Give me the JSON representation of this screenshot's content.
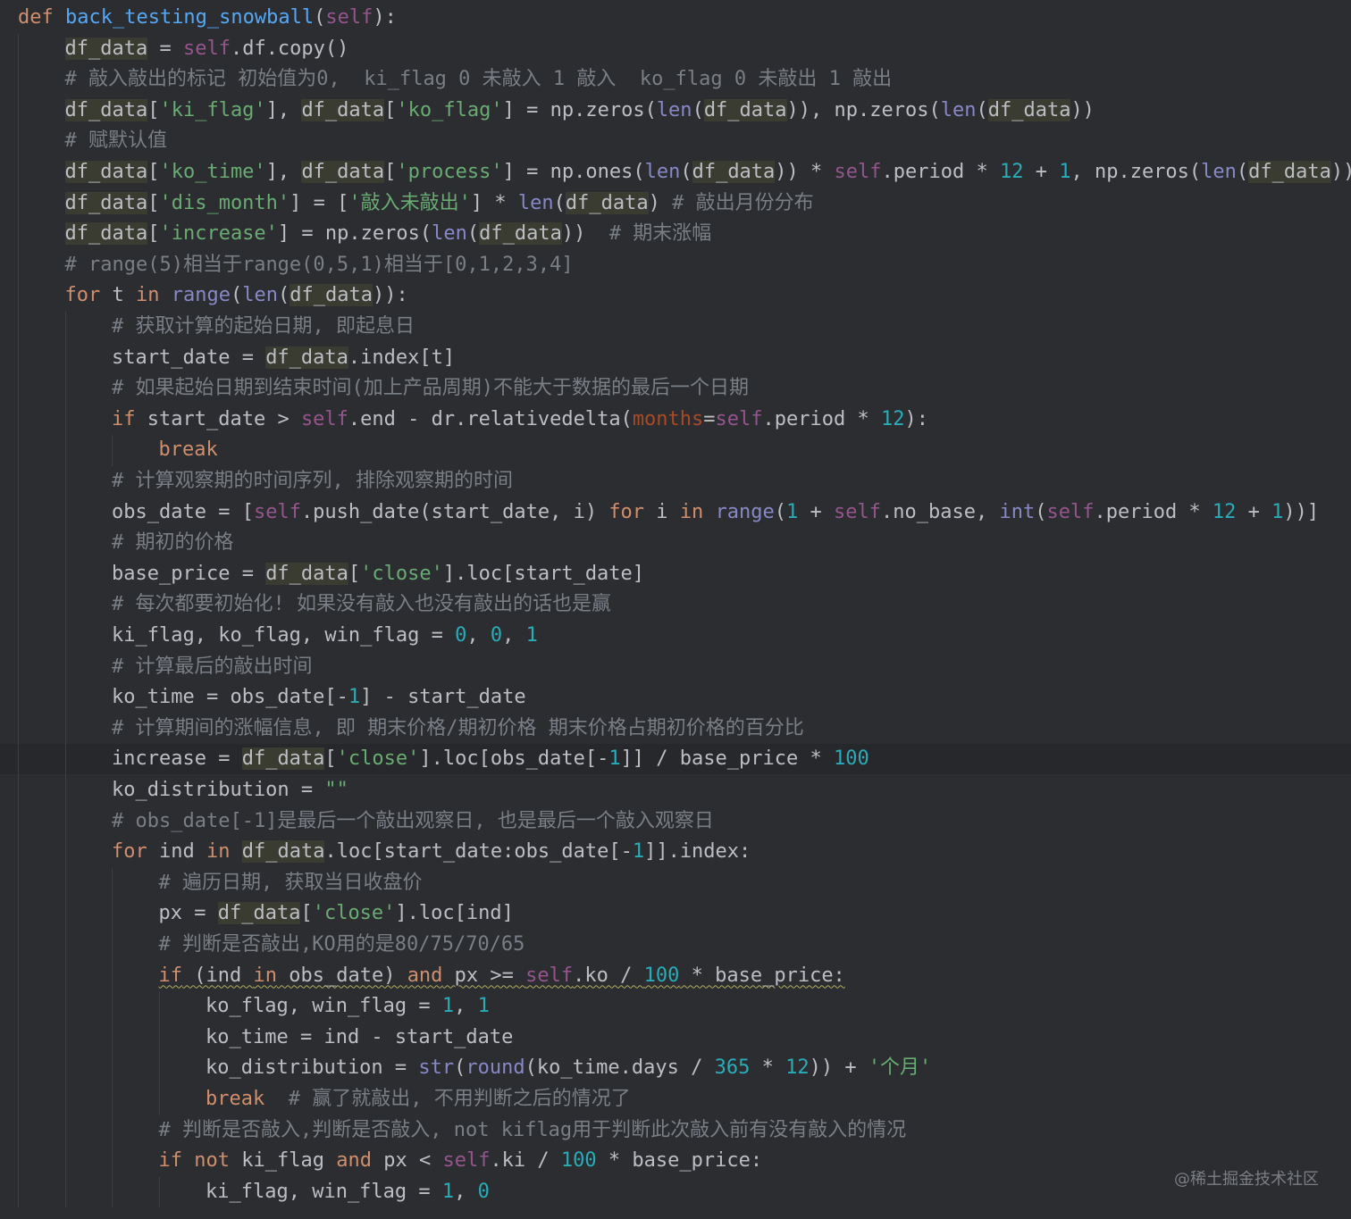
{
  "colors": {
    "background": "#2b2d30",
    "current_line": "#26282b",
    "default_text": "#bcbec4",
    "keyword": "#cf8e6d",
    "function_name": "#56a8f5",
    "builtin": "#8888c6",
    "self": "#94558d",
    "string": "#6aab73",
    "number": "#2aacb8",
    "comment": "#7a7e85",
    "named_param": "#aa4926"
  },
  "editor": {
    "current_line_index": 24,
    "lines": [
      {
        "indent": 0,
        "tokens": [
          [
            "kw",
            "def "
          ],
          [
            "fn",
            "back_testing_snowball"
          ],
          [
            "p",
            "("
          ],
          [
            "slf",
            "self"
          ],
          [
            "p",
            "):"
          ]
        ]
      },
      {
        "indent": 1,
        "tokens": [
          [
            "var",
            "df_data"
          ],
          [
            "p",
            " = "
          ],
          [
            "slf",
            "self"
          ],
          [
            "p",
            ".df.copy()"
          ]
        ]
      },
      {
        "indent": 1,
        "tokens": [
          [
            "cmt",
            "# 敲入敲出的标记 初始值为0,  ki_flag 0 未敲入 1 敲入  ko_flag 0 未敲出 1 敲出"
          ]
        ]
      },
      {
        "indent": 1,
        "tokens": [
          [
            "var",
            "df_data"
          ],
          [
            "p",
            "["
          ],
          [
            "str",
            "'ki_flag'"
          ],
          [
            "p",
            "], "
          ],
          [
            "var",
            "df_data"
          ],
          [
            "p",
            "["
          ],
          [
            "str",
            "'ko_flag'"
          ],
          [
            "p",
            "] = np.zeros("
          ],
          [
            "bi",
            "len"
          ],
          [
            "p",
            "("
          ],
          [
            "var",
            "df_data"
          ],
          [
            "p",
            ")), np.zeros("
          ],
          [
            "bi",
            "len"
          ],
          [
            "p",
            "("
          ],
          [
            "var",
            "df_data"
          ],
          [
            "p",
            "))"
          ]
        ]
      },
      {
        "indent": 1,
        "tokens": [
          [
            "cmt",
            "# 赋默认值"
          ]
        ]
      },
      {
        "indent": 1,
        "tokens": [
          [
            "var",
            "df_data"
          ],
          [
            "p",
            "["
          ],
          [
            "str",
            "'ko_time'"
          ],
          [
            "p",
            "], "
          ],
          [
            "var",
            "df_data"
          ],
          [
            "p",
            "["
          ],
          [
            "str",
            "'process'"
          ],
          [
            "p",
            "] = np.ones("
          ],
          [
            "bi",
            "len"
          ],
          [
            "p",
            "("
          ],
          [
            "var",
            "df_data"
          ],
          [
            "p",
            ")) * "
          ],
          [
            "slf",
            "self"
          ],
          [
            "p",
            ".period * "
          ],
          [
            "num",
            "12"
          ],
          [
            "p",
            " + "
          ],
          [
            "num",
            "1"
          ],
          [
            "p",
            ", np.zeros("
          ],
          [
            "bi",
            "len"
          ],
          [
            "p",
            "("
          ],
          [
            "var",
            "df_data"
          ],
          [
            "p",
            "))"
          ]
        ]
      },
      {
        "indent": 1,
        "tokens": [
          [
            "var",
            "df_data"
          ],
          [
            "p",
            "["
          ],
          [
            "str",
            "'dis_month'"
          ],
          [
            "p",
            "] = ["
          ],
          [
            "str",
            "'敲入未敲出'"
          ],
          [
            "p",
            "] * "
          ],
          [
            "bi",
            "len"
          ],
          [
            "p",
            "("
          ],
          [
            "var",
            "df_data"
          ],
          [
            "p",
            ") "
          ],
          [
            "cmt",
            "# 敲出月份分布"
          ]
        ]
      },
      {
        "indent": 1,
        "tokens": [
          [
            "var",
            "df_data"
          ],
          [
            "p",
            "["
          ],
          [
            "str",
            "'increase'"
          ],
          [
            "p",
            "] = np.zeros("
          ],
          [
            "bi",
            "len"
          ],
          [
            "p",
            "("
          ],
          [
            "var",
            "df_data"
          ],
          [
            "p",
            "))  "
          ],
          [
            "cmt",
            "# 期末涨幅"
          ]
        ]
      },
      {
        "indent": 1,
        "tokens": [
          [
            "cmt",
            "# range(5)相当于range(0,5,1)相当于[0,1,2,3,4]"
          ]
        ]
      },
      {
        "indent": 1,
        "tokens": [
          [
            "kw",
            "for"
          ],
          [
            "p",
            " t "
          ],
          [
            "kw",
            "in"
          ],
          [
            "p",
            " "
          ],
          [
            "bi",
            "range"
          ],
          [
            "p",
            "("
          ],
          [
            "bi",
            "len"
          ],
          [
            "p",
            "("
          ],
          [
            "var",
            "df_data"
          ],
          [
            "p",
            "))"
          ],
          [
            "p",
            ":"
          ]
        ]
      },
      {
        "indent": 2,
        "tokens": [
          [
            "cmt",
            "# 获取计算的起始日期, 即起息日"
          ]
        ]
      },
      {
        "indent": 2,
        "tokens": [
          [
            "p",
            "start_date = "
          ],
          [
            "var",
            "df_data"
          ],
          [
            "p",
            ".index[t]"
          ]
        ]
      },
      {
        "indent": 2,
        "tokens": [
          [
            "cmt",
            "# 如果起始日期到结束时间(加上产品周期)不能大于数据的最后一个日期"
          ]
        ]
      },
      {
        "indent": 2,
        "tokens": [
          [
            "kw",
            "if"
          ],
          [
            "p",
            " start_date > "
          ],
          [
            "slf",
            "self"
          ],
          [
            "p",
            ".end - dr.relativedelta("
          ],
          [
            "prm",
            "months"
          ],
          [
            "p",
            "="
          ],
          [
            "slf",
            "self"
          ],
          [
            "p",
            ".period * "
          ],
          [
            "num",
            "12"
          ],
          [
            "p",
            "):"
          ]
        ]
      },
      {
        "indent": 3,
        "tokens": [
          [
            "kw",
            "break"
          ]
        ]
      },
      {
        "indent": 2,
        "tokens": [
          [
            "cmt",
            "# 计算观察期的时间序列, 排除观察期的时间"
          ]
        ]
      },
      {
        "indent": 2,
        "tokens": [
          [
            "p",
            "obs_date = ["
          ],
          [
            "slf",
            "self"
          ],
          [
            "p",
            ".push_date(start_date, i) "
          ],
          [
            "kw",
            "for"
          ],
          [
            "p",
            " i "
          ],
          [
            "kw",
            "in"
          ],
          [
            "p",
            " "
          ],
          [
            "bi",
            "range"
          ],
          [
            "p",
            "("
          ],
          [
            "num",
            "1"
          ],
          [
            "p",
            " + "
          ],
          [
            "slf",
            "self"
          ],
          [
            "p",
            ".no_base, "
          ],
          [
            "bi",
            "int"
          ],
          [
            "p",
            "("
          ],
          [
            "slf",
            "self"
          ],
          [
            "p",
            ".period * "
          ],
          [
            "num",
            "12"
          ],
          [
            "p",
            " + "
          ],
          [
            "num",
            "1"
          ],
          [
            "p",
            "))]"
          ]
        ]
      },
      {
        "indent": 2,
        "tokens": [
          [
            "cmt",
            "# 期初的价格"
          ]
        ]
      },
      {
        "indent": 2,
        "tokens": [
          [
            "p",
            "base_price = "
          ],
          [
            "var",
            "df_data"
          ],
          [
            "p",
            "["
          ],
          [
            "str",
            "'close'"
          ],
          [
            "p",
            "].loc[start_date]"
          ]
        ]
      },
      {
        "indent": 2,
        "tokens": [
          [
            "cmt",
            "# 每次都要初始化! 如果没有敲入也没有敲出的话也是赢"
          ]
        ]
      },
      {
        "indent": 2,
        "tokens": [
          [
            "p",
            "ki_flag, ko_flag, win_flag = "
          ],
          [
            "num",
            "0"
          ],
          [
            "p",
            ", "
          ],
          [
            "num",
            "0"
          ],
          [
            "p",
            ", "
          ],
          [
            "num",
            "1"
          ]
        ]
      },
      {
        "indent": 2,
        "tokens": [
          [
            "cmt",
            "# 计算最后的敲出时间"
          ]
        ]
      },
      {
        "indent": 2,
        "tokens": [
          [
            "p",
            "ko_time = obs_date[-"
          ],
          [
            "num",
            "1"
          ],
          [
            "p",
            "] - start_date"
          ]
        ]
      },
      {
        "indent": 2,
        "tokens": [
          [
            "cmt",
            "# 计算期间的涨幅信息, 即 期末价格/期初价格 期末价格占期初价格的百分比"
          ]
        ]
      },
      {
        "indent": 2,
        "tokens": [
          [
            "p",
            "increase = "
          ],
          [
            "var",
            "df_data"
          ],
          [
            "p",
            "["
          ],
          [
            "str",
            "'close'"
          ],
          [
            "p",
            "].loc[obs_date[-"
          ],
          [
            "num",
            "1"
          ],
          [
            "p",
            "]] / base_price * "
          ],
          [
            "num",
            "100"
          ]
        ]
      },
      {
        "indent": 2,
        "tokens": [
          [
            "p",
            "ko_distribution = "
          ],
          [
            "str",
            "\"\""
          ]
        ]
      },
      {
        "indent": 2,
        "tokens": [
          [
            "cmt",
            "# obs_date[-1]是最后一个敲出观察日, 也是最后一个敲入观察日"
          ]
        ]
      },
      {
        "indent": 2,
        "tokens": [
          [
            "kw",
            "for"
          ],
          [
            "p",
            " ind "
          ],
          [
            "kw",
            "in"
          ],
          [
            "p",
            " "
          ],
          [
            "var",
            "df_data"
          ],
          [
            "p",
            ".loc[start_date:obs_date[-"
          ],
          [
            "num",
            "1"
          ],
          [
            "p",
            "]].index:"
          ]
        ]
      },
      {
        "indent": 3,
        "tokens": [
          [
            "cmt",
            "# 遍历日期, 获取当日收盘价"
          ]
        ]
      },
      {
        "indent": 3,
        "tokens": [
          [
            "p",
            "px = "
          ],
          [
            "var",
            "df_data"
          ],
          [
            "p",
            "["
          ],
          [
            "str",
            "'close'"
          ],
          [
            "p",
            "].loc[ind]"
          ]
        ]
      },
      {
        "indent": 3,
        "tokens": [
          [
            "cmt",
            "# 判断是否敲出,KO用的是80/75/70/65"
          ]
        ]
      },
      {
        "indent": 3,
        "wavy": true,
        "tokens": [
          [
            "kw",
            "if"
          ],
          [
            "p",
            " (ind "
          ],
          [
            "kw",
            "in"
          ],
          [
            "p",
            " obs_date) "
          ],
          [
            "kw",
            "and"
          ],
          [
            "p",
            " px >= "
          ],
          [
            "slf",
            "self"
          ],
          [
            "p",
            ".ko / "
          ],
          [
            "num",
            "100"
          ],
          [
            "p",
            " * base_price:"
          ]
        ]
      },
      {
        "indent": 4,
        "tokens": [
          [
            "p",
            "ko_flag, win_flag = "
          ],
          [
            "num",
            "1"
          ],
          [
            "p",
            ", "
          ],
          [
            "num",
            "1"
          ]
        ]
      },
      {
        "indent": 4,
        "tokens": [
          [
            "p",
            "ko_time = ind - start_date"
          ]
        ]
      },
      {
        "indent": 4,
        "tokens": [
          [
            "p",
            "ko_distribution = "
          ],
          [
            "bi",
            "str"
          ],
          [
            "p",
            "("
          ],
          [
            "bi",
            "round"
          ],
          [
            "p",
            "(ko_time.days / "
          ],
          [
            "num",
            "365"
          ],
          [
            "p",
            " * "
          ],
          [
            "num",
            "12"
          ],
          [
            "p",
            ")) + "
          ],
          [
            "str",
            "'个月'"
          ]
        ]
      },
      {
        "indent": 4,
        "tokens": [
          [
            "kw",
            "break"
          ],
          [
            "p",
            "  "
          ],
          [
            "cmt",
            "# 赢了就敲出, 不用判断之后的情况了"
          ]
        ]
      },
      {
        "indent": 3,
        "tokens": [
          [
            "cmt",
            "# 判断是否敲入,判断是否敲入, not kiflag用于判断此次敲入前有没有敲入的情况"
          ]
        ]
      },
      {
        "indent": 3,
        "tokens": [
          [
            "kw",
            "if"
          ],
          [
            "p",
            " "
          ],
          [
            "kw",
            "not"
          ],
          [
            "p",
            " ki_flag "
          ],
          [
            "kw",
            "and"
          ],
          [
            "p",
            " px < "
          ],
          [
            "slf",
            "self"
          ],
          [
            "p",
            ".ki / "
          ],
          [
            "num",
            "100"
          ],
          [
            "p",
            " * base_price:"
          ]
        ]
      },
      {
        "indent": 4,
        "tokens": [
          [
            "p",
            "ki_flag, win_flag = "
          ],
          [
            "num",
            "1"
          ],
          [
            "p",
            ", "
          ],
          [
            "num",
            "0"
          ]
        ]
      }
    ]
  },
  "watermark": {
    "text": "@稀土掘金技术社区"
  }
}
